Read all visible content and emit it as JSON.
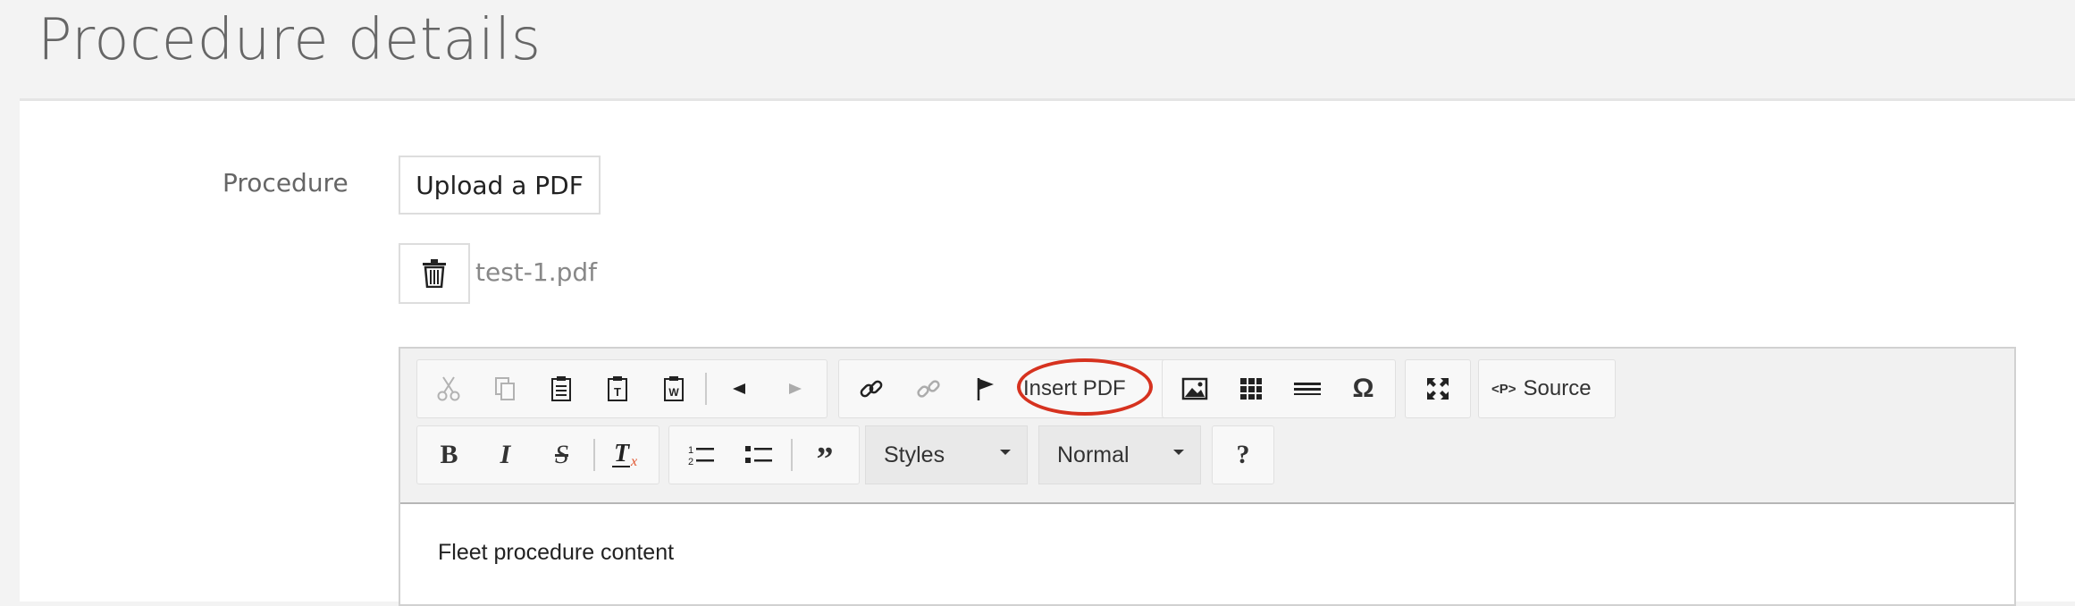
{
  "page": {
    "title": "Procedure details"
  },
  "form": {
    "procedure_label": "Procedure",
    "upload_label": "Upload a PDF",
    "file_name": "test-1.pdf"
  },
  "editor": {
    "toolbar": {
      "insert_pdf_label": "Insert PDF",
      "source_label": "Source",
      "styles_value": "Styles",
      "format_value": "Normal",
      "help_label": "?",
      "highlight_color": "#d6321f"
    },
    "content_text": "Fleet procedure content"
  }
}
